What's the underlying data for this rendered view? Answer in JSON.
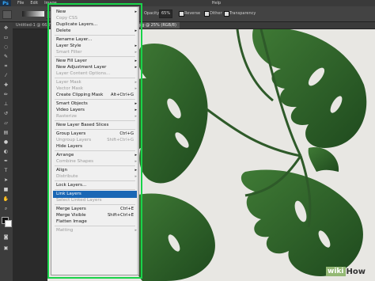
{
  "app": {
    "logo": "Ps",
    "menus": [
      "File",
      "Edit",
      "Image",
      "Layer",
      "Type",
      "Select",
      "Filter",
      "3D",
      "View",
      "Window",
      "Help"
    ]
  },
  "options_bar": {
    "opacity_label": "Opacity:",
    "opacity_value": "65%",
    "reverse": "Reverse",
    "dither": "Dither",
    "transparency": "Transparency"
  },
  "tabs": [
    {
      "label": "Untitled-1 @ 66.7..."
    },
    {
      "label": "...jpg @ 25% (RGB/8)"
    }
  ],
  "menu": {
    "items": [
      {
        "label": "New",
        "submenu": true,
        "disabled": false
      },
      {
        "label": "Copy CSS",
        "disabled": true
      },
      {
        "label": "Duplicate Layers...",
        "disabled": false
      },
      {
        "label": "Delete",
        "submenu": true,
        "disabled": false
      },
      {
        "separator": true
      },
      {
        "label": "Rename Layer...",
        "disabled": false
      },
      {
        "label": "Layer Style",
        "submenu": true,
        "disabled": false
      },
      {
        "label": "Smart Filter",
        "submenu": true,
        "disabled": true
      },
      {
        "separator": true
      },
      {
        "label": "New Fill Layer",
        "submenu": true,
        "disabled": false
      },
      {
        "label": "New Adjustment Layer",
        "submenu": true,
        "disabled": false
      },
      {
        "label": "Layer Content Options...",
        "disabled": true
      },
      {
        "separator": true
      },
      {
        "label": "Layer Mask",
        "submenu": true,
        "disabled": true
      },
      {
        "label": "Vector Mask",
        "submenu": true,
        "disabled": true
      },
      {
        "label": "Create Clipping Mask",
        "shortcut": "Alt+Ctrl+G",
        "disabled": false
      },
      {
        "separator": true
      },
      {
        "label": "Smart Objects",
        "submenu": true,
        "disabled": false
      },
      {
        "label": "Video Layers",
        "submenu": true,
        "disabled": false
      },
      {
        "label": "Rasterize",
        "submenu": true,
        "disabled": true
      },
      {
        "separator": true
      },
      {
        "label": "New Layer Based Slices",
        "disabled": false
      },
      {
        "separator": true
      },
      {
        "label": "Group Layers",
        "shortcut": "Ctrl+G",
        "disabled": false
      },
      {
        "label": "Ungroup Layers",
        "shortcut": "Shift+Ctrl+G",
        "disabled": true
      },
      {
        "label": "Hide Layers",
        "disabled": false
      },
      {
        "separator": true
      },
      {
        "label": "Arrange",
        "submenu": true,
        "disabled": false
      },
      {
        "label": "Combine Shapes",
        "submenu": true,
        "disabled": true
      },
      {
        "separator": true
      },
      {
        "label": "Align",
        "submenu": true,
        "disabled": false
      },
      {
        "label": "Distribute",
        "submenu": true,
        "disabled": true
      },
      {
        "separator": true
      },
      {
        "label": "Lock Layers...",
        "disabled": false
      },
      {
        "separator": true
      },
      {
        "label": "Link Layers",
        "disabled": false,
        "highlighted": true
      },
      {
        "label": "Select Linked Layers",
        "disabled": true
      },
      {
        "separator": true
      },
      {
        "label": "Merge Layers",
        "shortcut": "Ctrl+E",
        "disabled": false
      },
      {
        "label": "Merge Visible",
        "shortcut": "Shift+Ctrl+E",
        "disabled": false
      },
      {
        "label": "Flatten Image",
        "disabled": false
      },
      {
        "separator": true
      },
      {
        "label": "Matting",
        "submenu": true,
        "disabled": true
      }
    ]
  },
  "watermark": {
    "part1": "wiki",
    "part2": "How"
  },
  "colors": {
    "highlight": "#1a67b5",
    "frame": "#19d34a",
    "leaf": "#2d5a2a",
    "canvas_bg": "#e8e7e3"
  }
}
